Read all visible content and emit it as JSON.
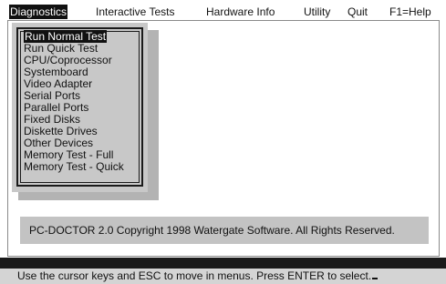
{
  "menubar": {
    "items": [
      "Diagnostics",
      "Interactive Tests",
      "Hardware Info",
      "Utility",
      "Quit",
      "F1=Help"
    ],
    "active_index": 0
  },
  "diagnostics_menu": {
    "items": [
      "Run Normal Test",
      "Run Quick Test",
      "CPU/Coprocessor",
      "Systemboard",
      "Video Adapter",
      "Serial Ports",
      "Parallel Ports",
      "Fixed Disks",
      "Diskette Drives",
      "Other Devices",
      "Memory Test - Full",
      "Memory Test - Quick"
    ],
    "selected_index": 0
  },
  "copyright": "PC-DOCTOR 2.0  Copyright  1998 Watergate Software.  All Rights Reserved.",
  "status": "Use the cursor keys and ESC to move in menus.  Press ENTER to select.",
  "colors": {
    "background": "#ffffff",
    "text": "#111111",
    "highlight": "#111111",
    "panel": "#c8c8c8",
    "status_bar": "#d4d4d4"
  }
}
